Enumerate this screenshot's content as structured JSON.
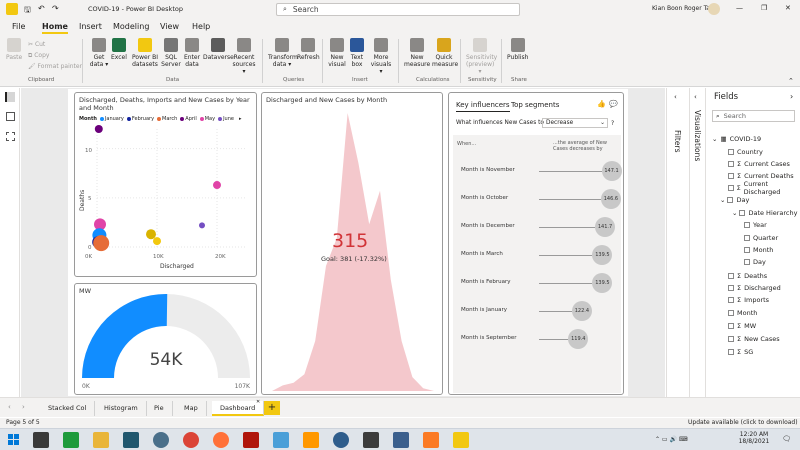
{
  "titlebar": {
    "title": "COVID-19 - Power BI Desktop",
    "search_placeholder": "Search",
    "user": "Kian Boon Roger Tan",
    "minimize": "—",
    "restore": "❐",
    "close": "✕"
  },
  "menu": [
    "File",
    "Home",
    "Insert",
    "Modeling",
    "View",
    "Help"
  ],
  "ribbon": {
    "clipboard": {
      "paste": "Paste",
      "cut": "Cut",
      "copy": "Copy",
      "format_painter": "Format painter",
      "group": "Clipboard"
    },
    "data": {
      "items": [
        "Get data ▾",
        "Excel",
        "Power BI datasets",
        "SQL Server",
        "Enter data",
        "Dataverse",
        "Recent sources ▾"
      ],
      "group": "Data"
    },
    "queries": {
      "items": [
        "Transform data ▾",
        "Refresh"
      ],
      "group": "Queries"
    },
    "insert": {
      "items": [
        "New visual",
        "Text box",
        "More visuals ▾"
      ],
      "group": "Insert"
    },
    "calculations": {
      "items": [
        "New measure",
        "Quick measure"
      ],
      "group": "Calculations"
    },
    "sensitivity": {
      "items": [
        "Sensitivity (preview) ▾"
      ],
      "group": "Sensitivity"
    },
    "share": {
      "items": [
        "Publish"
      ],
      "group": "Share"
    }
  },
  "scatter_visual": {
    "title": "Discharged, Deaths, Imports and New Cases by Year and Month",
    "legend_label": "Month",
    "legend": [
      {
        "name": "January",
        "color": "#118dff"
      },
      {
        "name": "February",
        "color": "#12239e"
      },
      {
        "name": "March",
        "color": "#e66c37"
      },
      {
        "name": "April",
        "color": "#6b007b"
      },
      {
        "name": "May",
        "color": "#e044a7"
      },
      {
        "name": "June",
        "color": "#744ec2"
      }
    ],
    "xlabel": "Discharged",
    "ylabel": "Deaths",
    "xticks": [
      "0K",
      "10K",
      "20K"
    ],
    "yticks": [
      "10",
      "5",
      "0"
    ]
  },
  "chart_data": [
    {
      "type": "scatter",
      "title": "Discharged, Deaths, Imports and New Cases by Year and Month",
      "xlabel": "Discharged",
      "ylabel": "Deaths",
      "xlim": [
        0,
        25000
      ],
      "ylim": [
        0,
        12
      ],
      "points": [
        {
          "x": 300,
          "y": 12,
          "size": 4,
          "color": "#6b007b"
        },
        {
          "x": 500,
          "y": 2.3,
          "size": 6,
          "color": "#e044a7"
        },
        {
          "x": 400,
          "y": 1.2,
          "size": 7,
          "color": "#118dff"
        },
        {
          "x": 200,
          "y": 0.5,
          "size": 6,
          "color": "#12239e"
        },
        {
          "x": 700,
          "y": 0.4,
          "size": 8,
          "color": "#e66c37"
        },
        {
          "x": 10000,
          "y": 0.6,
          "size": 4,
          "color": "#f2c80f"
        },
        {
          "x": 9000,
          "y": 1.3,
          "size": 5,
          "color": "#d9b300"
        },
        {
          "x": 20000,
          "y": 6.3,
          "size": 4,
          "color": "#e044a7"
        },
        {
          "x": 17500,
          "y": 2.2,
          "size": 3,
          "color": "#744ec2"
        }
      ]
    },
    {
      "type": "area",
      "title": "Discharged and New Cases by Month",
      "series": [
        {
          "values": [
            0,
            2,
            3,
            6,
            18,
            45,
            55,
            100,
            82,
            60,
            72,
            40,
            18,
            5,
            1,
            0
          ]
        }
      ],
      "ylim": [
        0,
        100
      ],
      "color": "#f4c8cc"
    },
    {
      "type": "gauge",
      "title": "MW",
      "value": 54000,
      "min": 0,
      "max": 107000,
      "value_label": "54K",
      "min_label": "0K",
      "max_label": "107K"
    }
  ],
  "area_visual": {
    "title": "Discharged and New Cases by Month",
    "kpi": "315",
    "goal": "Goal: 381 (-17.32%)"
  },
  "gauge_visual": {
    "title": "MW",
    "value_label": "54K",
    "min_label": "0K",
    "max_label": "107K"
  },
  "key_influencers": {
    "tab1": "Key influencers",
    "tab2": "Top segments",
    "question": "What influences New Cases to",
    "dropdown": "Decrease",
    "help": "?",
    "when_label": "When...",
    "avg_label": "...the average of New Cases decreases by",
    "rows": [
      {
        "label": "Month is November",
        "value": "147.1"
      },
      {
        "label": "Month is October",
        "value": "146.6"
      },
      {
        "label": "Month is December",
        "value": "141.7"
      },
      {
        "label": "Month is March",
        "value": "139.5"
      },
      {
        "label": "Month is February",
        "value": "139.5"
      },
      {
        "label": "Month is January",
        "value": "122.4"
      },
      {
        "label": "Month is September",
        "value": "119.4"
      }
    ]
  },
  "panes": {
    "filters": "Filters",
    "visualizations": "Visualizations",
    "fields_title": "Fields",
    "fields_search": "Search"
  },
  "fields": {
    "table": "COVID-19",
    "items": [
      "Country",
      "Current Cases",
      "Current Deaths",
      "Current Discharged",
      "Day",
      "Date Hierarchy",
      "Year",
      "Quarter",
      "Month",
      "Day",
      "Deaths",
      "Discharged",
      "Imports",
      "Month",
      "MW",
      "New Cases",
      "SG"
    ]
  },
  "tabs": [
    "Stacked Col",
    "Histogram",
    "Pie",
    "Map",
    "Dashboard"
  ],
  "add_tab": "+",
  "status": {
    "page": "Page 5 of 5",
    "update": "Update available (click to download)"
  },
  "taskbar": {
    "time": "12:20 AM",
    "date": "18/8/2021"
  }
}
